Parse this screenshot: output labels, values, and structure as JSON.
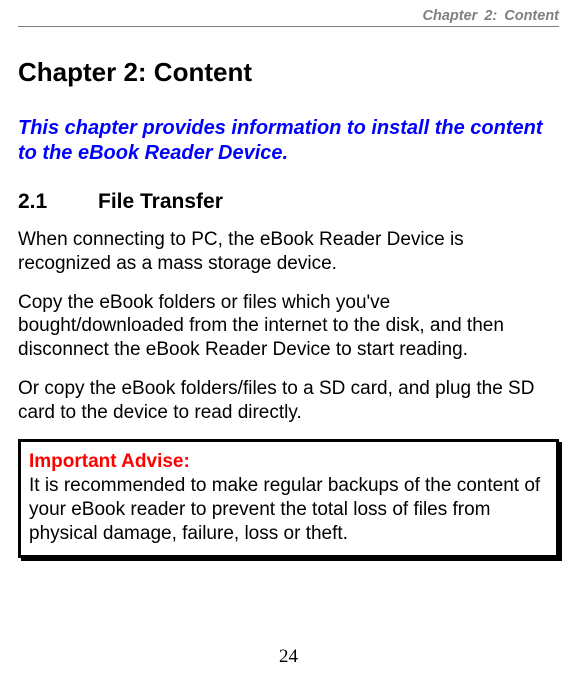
{
  "header": {
    "running_title": "Chapter 2: Content"
  },
  "chapter": {
    "title": "Chapter 2: Content",
    "intro": "This chapter provides information to install the content to the eBook Reader Device."
  },
  "section": {
    "number": "2.1",
    "title": "File Transfer"
  },
  "paragraphs": {
    "p1": "When connecting to PC, the eBook Reader Device is recognized as a mass storage device.",
    "p2": "Copy the eBook folders or files which you've bought/downloaded from the internet to the disk, and then disconnect the eBook Reader Device to start reading.",
    "p3": "Or copy the eBook folders/files to a SD card, and plug the SD card to the device to read directly."
  },
  "advise": {
    "title": "Important Advise:",
    "body": "It is recommended to make regular backups of the content of your eBook reader to prevent the total loss of files from physical damage, failure, loss or theft."
  },
  "page_number": "24"
}
